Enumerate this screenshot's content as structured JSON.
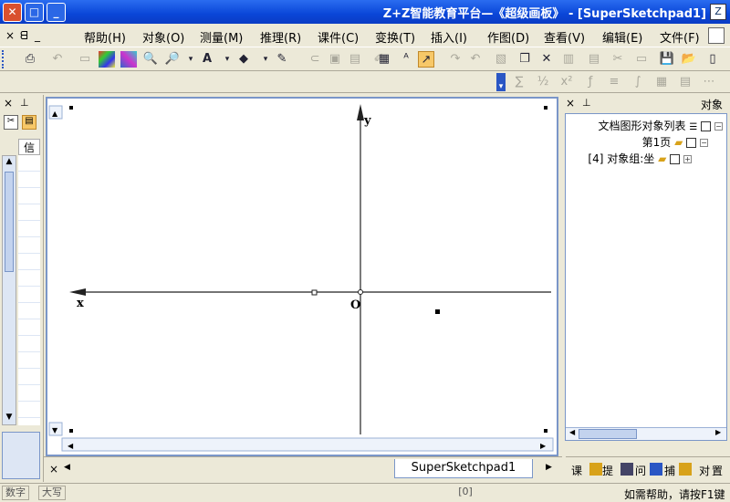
{
  "window": {
    "title": "Z+Z智能教育平台—《超级画板》 - [SuperSketchpad1]",
    "app_icon": "Z",
    "buttons": {
      "close": "✕",
      "maximize": "□",
      "minimize": "_"
    }
  },
  "menubar": {
    "items": [
      {
        "label": "文件(F)"
      },
      {
        "label": "编辑(E)"
      },
      {
        "label": "查看(V)"
      },
      {
        "label": "作图(D)"
      },
      {
        "label": "插入(I)"
      },
      {
        "label": "变换(T)"
      },
      {
        "label": "课件(C)"
      },
      {
        "label": "推理(R)"
      },
      {
        "label": "测量(M)"
      },
      {
        "label": "对象(O)"
      },
      {
        "label": "帮助(H)"
      }
    ],
    "mdi": {
      "close": "×",
      "restore": "ᗺ",
      "minimize": "_"
    }
  },
  "toolbar": {
    "icons": [
      "new-icon",
      "open-icon",
      "save-icon",
      "print-preview-icon",
      "cut-icon",
      "copy-icon",
      "paste-icon",
      "delete-icon",
      "undo-icon",
      "redo-icon",
      "select-arrow-icon",
      "text-tool-icon",
      "erase-icon",
      "line-color-icon",
      "fill-color-icon",
      "font-color-icon",
      "zoom-in-icon",
      "zoom-out-icon",
      "grid-icon",
      "colors-icon",
      "dots-icon",
      "print-icon"
    ]
  },
  "canvas": {
    "axis_y_label": "y",
    "axis_x_label": "x",
    "origin_label": "O"
  },
  "left_panel": {
    "header": "信",
    "pin": "⊥",
    "close": "×"
  },
  "object_panel": {
    "title": "对象",
    "pin": "⊥",
    "close": "×",
    "tree": {
      "root": "文档图形对象列表",
      "page": "第1页",
      "group": "[4] 对象组:坐"
    }
  },
  "tabs": {
    "document": "SuperSketchpad1",
    "close": "×",
    "prev": "◀",
    "next": "▶"
  },
  "object_tabs": {
    "items": [
      "课",
      "对",
      "捕",
      "问",
      "提",
      "置"
    ]
  },
  "statusbar": {
    "help": "如需帮助，请按F1键",
    "coord": "[0]",
    "caps": "大写",
    "num": "数字"
  }
}
